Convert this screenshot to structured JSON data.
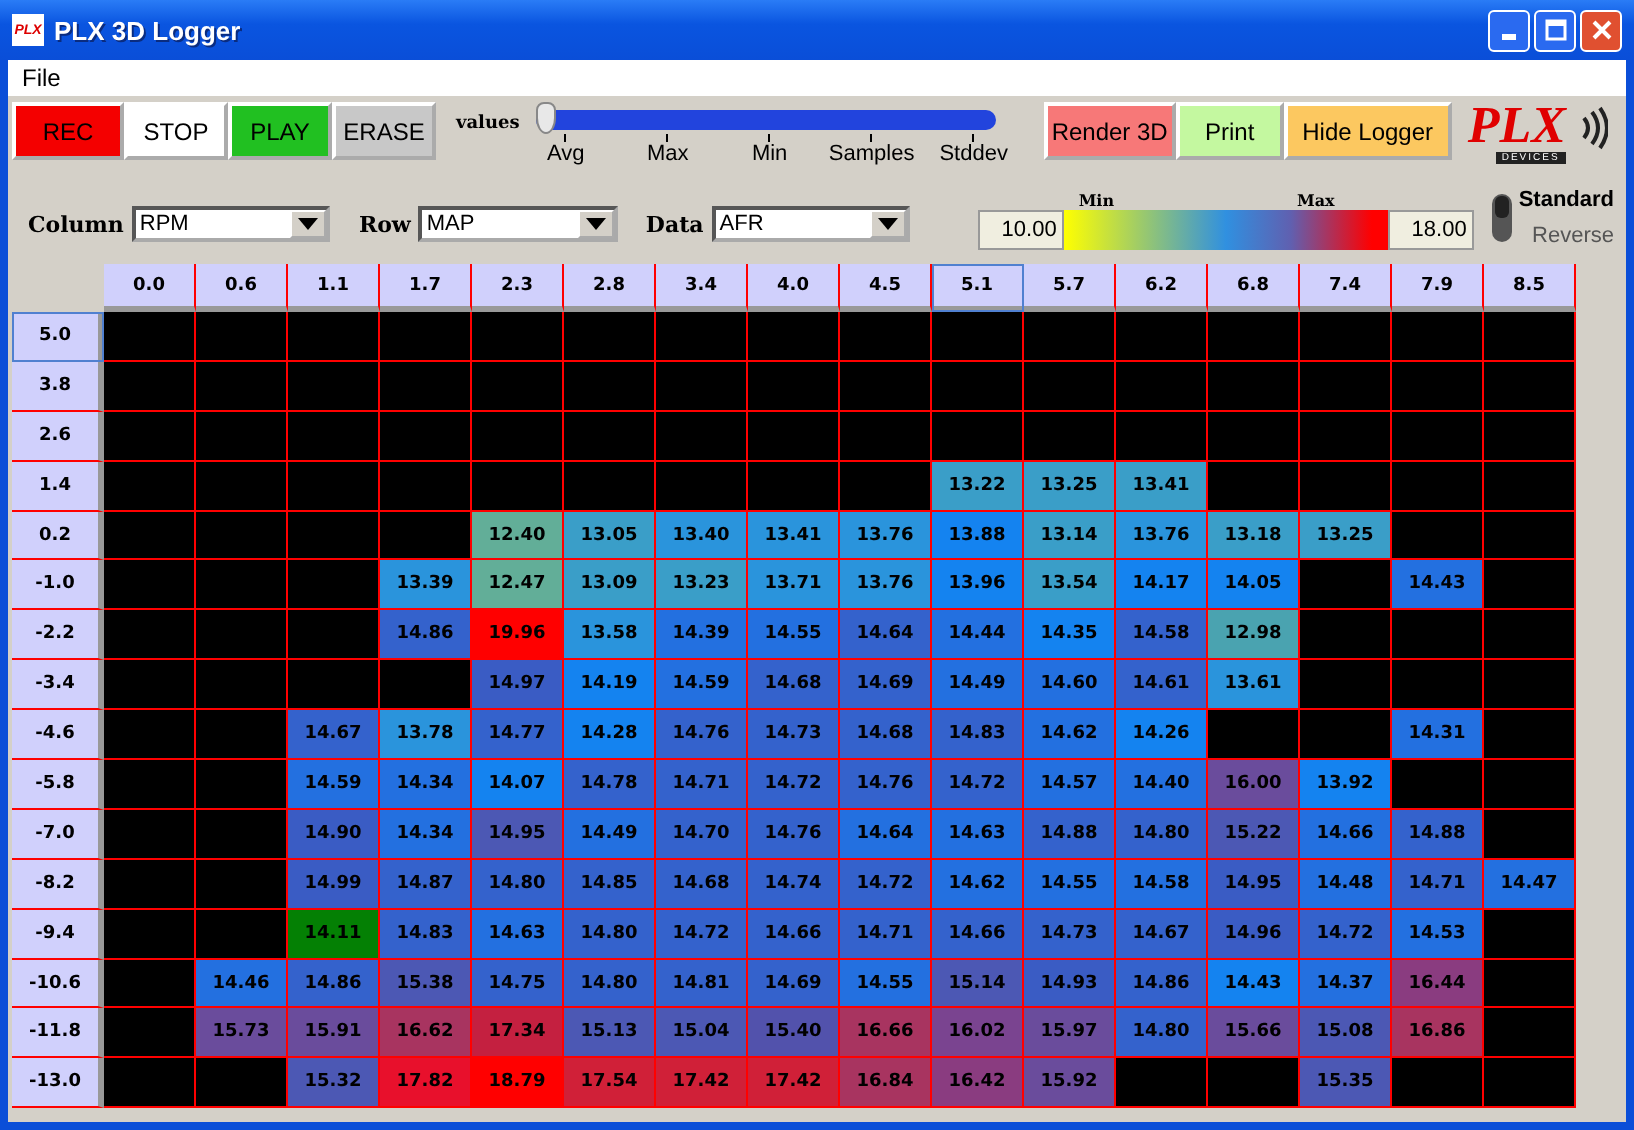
{
  "window": {
    "title": "PLX 3D Logger",
    "app_icon_text": "PLX"
  },
  "menu": [
    "File"
  ],
  "toolbar": {
    "buttons": [
      {
        "label": "REC",
        "kind": "rec"
      },
      {
        "label": "STOP",
        "kind": "stop"
      },
      {
        "label": "PLAY",
        "kind": "play"
      },
      {
        "label": "ERASE",
        "kind": "erase"
      }
    ],
    "slider": {
      "label": "values",
      "level": 0,
      "ticks": [
        "Avg",
        "Max",
        "Min",
        "Samples",
        "Stddev"
      ]
    },
    "actions": [
      {
        "label": "Render 3D",
        "kind": "render"
      },
      {
        "label": "Print",
        "kind": "print"
      },
      {
        "label": "Hide Logger",
        "kind": "hide"
      }
    ],
    "logo": {
      "text": "PLX",
      "subtext": "DEVICES"
    }
  },
  "selectors": [
    {
      "label": "Column",
      "value": "RPM"
    },
    {
      "label": "Row",
      "value": "MAP"
    },
    {
      "label": "Data",
      "value": "AFR"
    }
  ],
  "scale": {
    "min_label": "Min",
    "max_label": "Max",
    "min_value": "10.00",
    "max_value": "18.00"
  },
  "mode": [
    {
      "label": "Standard",
      "selected": true
    },
    {
      "label": "Reverse",
      "selected": false
    }
  ],
  "grid": {
    "columns": [
      {
        "label": "0.0",
        "selected": false
      },
      {
        "label": "0.6",
        "selected": false
      },
      {
        "label": "1.1",
        "selected": false
      },
      {
        "label": "1.7",
        "selected": false
      },
      {
        "label": "2.3",
        "selected": false
      },
      {
        "label": "2.8",
        "selected": false
      },
      {
        "label": "3.4",
        "selected": false
      },
      {
        "label": "4.0",
        "selected": false
      },
      {
        "label": "4.5",
        "selected": false
      },
      {
        "label": "5.1",
        "selected": true
      },
      {
        "label": "5.7",
        "selected": false
      },
      {
        "label": "6.2",
        "selected": false
      },
      {
        "label": "6.8",
        "selected": false
      },
      {
        "label": "7.4",
        "selected": false
      },
      {
        "label": "7.9",
        "selected": false
      },
      {
        "label": "8.5",
        "selected": false
      }
    ],
    "rows": [
      {
        "label": "5.0",
        "selected": true,
        "cells": [
          null,
          null,
          null,
          null,
          null,
          null,
          null,
          null,
          null,
          null,
          null,
          null,
          null,
          null,
          null,
          null
        ]
      },
      {
        "label": "3.8",
        "selected": false,
        "cells": [
          null,
          null,
          null,
          null,
          null,
          null,
          null,
          null,
          null,
          null,
          null,
          null,
          null,
          null,
          null,
          null
        ]
      },
      {
        "label": "2.6",
        "selected": false,
        "cells": [
          null,
          null,
          null,
          null,
          null,
          null,
          null,
          null,
          null,
          null,
          null,
          null,
          null,
          null,
          null,
          null
        ]
      },
      {
        "label": "1.4",
        "selected": false,
        "cells": [
          null,
          null,
          null,
          null,
          null,
          null,
          null,
          null,
          null,
          {
            "value": "13.22",
            "color": "#3a9ec8"
          },
          {
            "value": "13.25",
            "color": "#3a9ec8"
          },
          {
            "value": "13.41",
            "color": "#3a9ec8"
          },
          null,
          null,
          null,
          null
        ]
      },
      {
        "label": "0.2",
        "selected": false,
        "cells": [
          null,
          null,
          null,
          null,
          {
            "value": "12.40",
            "color": "#62ae98"
          },
          {
            "value": "13.05",
            "color": "#3a9ec8"
          },
          {
            "value": "13.40",
            "color": "#2a94dc"
          },
          {
            "value": "13.41",
            "color": "#2a94dc"
          },
          {
            "value": "13.76",
            "color": "#2a94dc"
          },
          {
            "value": "13.88",
            "color": "#1483f0"
          },
          {
            "value": "13.14",
            "color": "#3a9ec8"
          },
          {
            "value": "13.76",
            "color": "#2a94dc"
          },
          {
            "value": "13.18",
            "color": "#3a9ec8"
          },
          {
            "value": "13.25",
            "color": "#3a9ec8"
          },
          null,
          null
        ]
      },
      {
        "label": "-1.0",
        "selected": false,
        "cells": [
          null,
          null,
          null,
          {
            "value": "13.39",
            "color": "#2a94dc"
          },
          {
            "value": "12.47",
            "color": "#62ae98"
          },
          {
            "value": "13.09",
            "color": "#3a9ec8"
          },
          {
            "value": "13.23",
            "color": "#3a9ec8"
          },
          {
            "value": "13.71",
            "color": "#2a94dc"
          },
          {
            "value": "13.76",
            "color": "#2a94dc"
          },
          {
            "value": "13.96",
            "color": "#1483f0"
          },
          {
            "value": "13.54",
            "color": "#3a9ec8"
          },
          {
            "value": "14.17",
            "color": "#1483f0"
          },
          {
            "value": "14.05",
            "color": "#1483f0"
          },
          null,
          {
            "value": "14.43",
            "color": "#2370e0"
          },
          null
        ]
      },
      {
        "label": "-2.2",
        "selected": false,
        "cells": [
          null,
          null,
          null,
          {
            "value": "14.86",
            "color": "#3462cc"
          },
          {
            "value": "19.96",
            "color": "#ff0000"
          },
          {
            "value": "13.58",
            "color": "#2a94dc"
          },
          {
            "value": "14.39",
            "color": "#2370e0"
          },
          {
            "value": "14.55",
            "color": "#2370e0"
          },
          {
            "value": "14.64",
            "color": "#3462cc"
          },
          {
            "value": "14.44",
            "color": "#2370e0"
          },
          {
            "value": "14.35",
            "color": "#1483f0"
          },
          {
            "value": "14.58",
            "color": "#3462cc"
          },
          {
            "value": "12.98",
            "color": "#4aa3b0"
          },
          null,
          null,
          null
        ]
      },
      {
        "label": "-3.4",
        "selected": false,
        "cells": [
          null,
          null,
          null,
          null,
          {
            "value": "14.97",
            "color": "#3a5cc4"
          },
          {
            "value": "14.19",
            "color": "#1483f0"
          },
          {
            "value": "14.59",
            "color": "#2370e0"
          },
          {
            "value": "14.68",
            "color": "#3462cc"
          },
          {
            "value": "14.69",
            "color": "#3462cc"
          },
          {
            "value": "14.49",
            "color": "#2370e0"
          },
          {
            "value": "14.60",
            "color": "#2370e0"
          },
          {
            "value": "14.61",
            "color": "#3462cc"
          },
          {
            "value": "13.61",
            "color": "#2a94dc"
          },
          null,
          null,
          null
        ]
      },
      {
        "label": "-4.6",
        "selected": false,
        "cells": [
          null,
          null,
          {
            "value": "14.67",
            "color": "#3462cc"
          },
          {
            "value": "13.78",
            "color": "#2a94dc"
          },
          {
            "value": "14.77",
            "color": "#3462cc"
          },
          {
            "value": "14.28",
            "color": "#1483f0"
          },
          {
            "value": "14.76",
            "color": "#3462cc"
          },
          {
            "value": "14.73",
            "color": "#3462cc"
          },
          {
            "value": "14.68",
            "color": "#3462cc"
          },
          {
            "value": "14.83",
            "color": "#3462cc"
          },
          {
            "value": "14.62",
            "color": "#2370e0"
          },
          {
            "value": "14.26",
            "color": "#1483f0"
          },
          null,
          null,
          {
            "value": "14.31",
            "color": "#2370e0"
          },
          null
        ]
      },
      {
        "label": "-5.8",
        "selected": false,
        "cells": [
          null,
          null,
          {
            "value": "14.59",
            "color": "#2370e0"
          },
          {
            "value": "14.34",
            "color": "#2370e0"
          },
          {
            "value": "14.07",
            "color": "#1483f0"
          },
          {
            "value": "14.78",
            "color": "#3462cc"
          },
          {
            "value": "14.71",
            "color": "#3462cc"
          },
          {
            "value": "14.72",
            "color": "#3462cc"
          },
          {
            "value": "14.76",
            "color": "#3462cc"
          },
          {
            "value": "14.72",
            "color": "#3462cc"
          },
          {
            "value": "14.57",
            "color": "#2370e0"
          },
          {
            "value": "14.40",
            "color": "#2370e0"
          },
          {
            "value": "16.00",
            "color": "#6a4c9c"
          },
          {
            "value": "13.92",
            "color": "#1483f0"
          },
          null,
          null
        ]
      },
      {
        "label": "-7.0",
        "selected": false,
        "cells": [
          null,
          null,
          {
            "value": "14.90",
            "color": "#3a5cc4"
          },
          {
            "value": "14.34",
            "color": "#2370e0"
          },
          {
            "value": "14.95",
            "color": "#4c58b4"
          },
          {
            "value": "14.49",
            "color": "#2370e0"
          },
          {
            "value": "14.70",
            "color": "#3462cc"
          },
          {
            "value": "14.76",
            "color": "#3462cc"
          },
          {
            "value": "14.64",
            "color": "#2370e0"
          },
          {
            "value": "14.63",
            "color": "#2370e0"
          },
          {
            "value": "14.88",
            "color": "#3462cc"
          },
          {
            "value": "14.80",
            "color": "#3462cc"
          },
          {
            "value": "15.22",
            "color": "#4c58b4"
          },
          {
            "value": "14.66",
            "color": "#2370e0"
          },
          {
            "value": "14.88",
            "color": "#3462cc"
          },
          null
        ]
      },
      {
        "label": "-8.2",
        "selected": false,
        "cells": [
          null,
          null,
          {
            "value": "14.99",
            "color": "#3a5cc4"
          },
          {
            "value": "14.87",
            "color": "#3462cc"
          },
          {
            "value": "14.80",
            "color": "#3462cc"
          },
          {
            "value": "14.85",
            "color": "#3462cc"
          },
          {
            "value": "14.68",
            "color": "#3462cc"
          },
          {
            "value": "14.74",
            "color": "#3462cc"
          },
          {
            "value": "14.72",
            "color": "#3462cc"
          },
          {
            "value": "14.62",
            "color": "#2370e0"
          },
          {
            "value": "14.55",
            "color": "#2370e0"
          },
          {
            "value": "14.58",
            "color": "#2370e0"
          },
          {
            "value": "14.95",
            "color": "#3a5cc4"
          },
          {
            "value": "14.48",
            "color": "#2370e0"
          },
          {
            "value": "14.71",
            "color": "#3462cc"
          },
          {
            "value": "14.47",
            "color": "#2370e0"
          }
        ]
      },
      {
        "label": "-9.4",
        "selected": false,
        "cells": [
          null,
          null,
          {
            "value": "14.11",
            "color": "#048004"
          },
          {
            "value": "14.83",
            "color": "#3462cc"
          },
          {
            "value": "14.63",
            "color": "#2370e0"
          },
          {
            "value": "14.80",
            "color": "#3462cc"
          },
          {
            "value": "14.72",
            "color": "#3462cc"
          },
          {
            "value": "14.66",
            "color": "#3462cc"
          },
          {
            "value": "14.71",
            "color": "#3462cc"
          },
          {
            "value": "14.66",
            "color": "#3462cc"
          },
          {
            "value": "14.73",
            "color": "#3462cc"
          },
          {
            "value": "14.67",
            "color": "#3462cc"
          },
          {
            "value": "14.96",
            "color": "#3a5cc4"
          },
          {
            "value": "14.72",
            "color": "#3462cc"
          },
          {
            "value": "14.53",
            "color": "#2370e0"
          },
          null
        ]
      },
      {
        "label": "-10.6",
        "selected": false,
        "cells": [
          null,
          {
            "value": "14.46",
            "color": "#2370e0"
          },
          {
            "value": "14.86",
            "color": "#3462cc"
          },
          {
            "value": "15.38",
            "color": "#4c58b4"
          },
          {
            "value": "14.75",
            "color": "#3462cc"
          },
          {
            "value": "14.80",
            "color": "#3462cc"
          },
          {
            "value": "14.81",
            "color": "#3462cc"
          },
          {
            "value": "14.69",
            "color": "#3462cc"
          },
          {
            "value": "14.55",
            "color": "#2370e0"
          },
          {
            "value": "15.14",
            "color": "#4c58b4"
          },
          {
            "value": "14.93",
            "color": "#3a5cc4"
          },
          {
            "value": "14.86",
            "color": "#3462cc"
          },
          {
            "value": "14.43",
            "color": "#1483f0"
          },
          {
            "value": "14.37",
            "color": "#2370e0"
          },
          {
            "value": "16.44",
            "color": "#8a3c80"
          },
          null
        ]
      },
      {
        "label": "-11.8",
        "selected": false,
        "cells": [
          null,
          {
            "value": "15.73",
            "color": "#6a4c9c"
          },
          {
            "value": "15.91",
            "color": "#6a4c9c"
          },
          {
            "value": "16.62",
            "color": "#a83460"
          },
          {
            "value": "17.34",
            "color": "#c42040"
          },
          {
            "value": "15.13",
            "color": "#4c58b4"
          },
          {
            "value": "15.04",
            "color": "#4c58b4"
          },
          {
            "value": "15.40",
            "color": "#5252ac"
          },
          {
            "value": "16.66",
            "color": "#a83460"
          },
          {
            "value": "16.02",
            "color": "#7a4490"
          },
          {
            "value": "15.97",
            "color": "#6a4c9c"
          },
          {
            "value": "14.80",
            "color": "#3462cc"
          },
          {
            "value": "15.66",
            "color": "#6a4c9c"
          },
          {
            "value": "15.08",
            "color": "#4c58b4"
          },
          {
            "value": "16.86",
            "color": "#a83460"
          },
          null
        ]
      },
      {
        "label": "-13.0",
        "selected": false,
        "cells": [
          null,
          null,
          {
            "value": "15.32",
            "color": "#4c58b4"
          },
          {
            "value": "17.82",
            "color": "#e8102c"
          },
          {
            "value": "18.79",
            "color": "#ff0000"
          },
          {
            "value": "17.54",
            "color": "#d02038"
          },
          {
            "value": "17.42",
            "color": "#d02038"
          },
          {
            "value": "17.42",
            "color": "#d02038"
          },
          {
            "value": "16.84",
            "color": "#a83460"
          },
          {
            "value": "16.42",
            "color": "#8a3c80"
          },
          {
            "value": "15.92",
            "color": "#6a4c9c"
          },
          null,
          null,
          {
            "value": "15.35",
            "color": "#4c58b4"
          },
          null,
          null
        ]
      }
    ]
  }
}
